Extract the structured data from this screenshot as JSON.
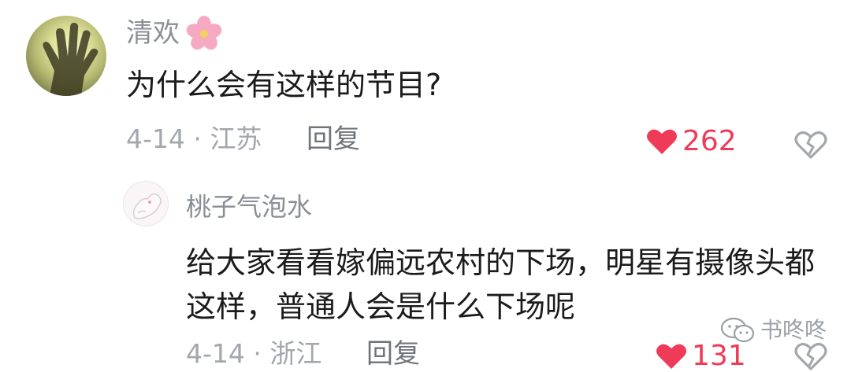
{
  "comment": {
    "username": "清欢",
    "emoji_icon": "cherry-blossom-icon",
    "text": "为什么会有这样的节目?",
    "date_location": "4-14 · 江苏",
    "reply_label": "回复",
    "like_count": "262"
  },
  "reply": {
    "username": "桃子气泡水",
    "text": "给大家看看嫁偏远农村的下场，明星有摄像头都这样，普通人会是什么下场呢",
    "date_location": "4-14 · 浙江",
    "reply_label": "回复",
    "like_count": "131"
  },
  "watermark": {
    "text": "书咚咚",
    "icon": "wechat-icon"
  },
  "colors": {
    "like_red": "#ef3a58",
    "meta_gray": "#a3a7ad",
    "username_gray": "#8a8f96",
    "text_black": "#1b1b1b"
  }
}
